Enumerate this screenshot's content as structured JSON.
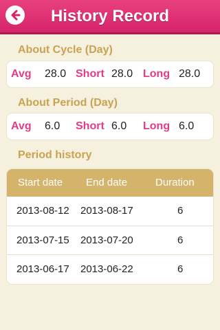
{
  "header": {
    "title": "History Record"
  },
  "icons": {
    "back": "back-arrow-icon"
  },
  "colors": {
    "accent": "#e23c86",
    "gold": "#c9a352",
    "header_bg": "#d6246a"
  },
  "cycle": {
    "label": "About Cycle (Day)",
    "avg_label": "Avg",
    "avg_value": "28.0",
    "short_label": "Short",
    "short_value": "28.0",
    "long_label": "Long",
    "long_value": "28.0"
  },
  "period": {
    "label": "About Period (Day)",
    "avg_label": "Avg",
    "avg_value": "6.0",
    "short_label": "Short",
    "short_value": "6.0",
    "long_label": "Long",
    "long_value": "6.0"
  },
  "history": {
    "label": "Period history",
    "columns": [
      "Start date",
      "End date",
      "Duration"
    ],
    "rows": [
      [
        "2013-08-12",
        "2013-08-17",
        "6"
      ],
      [
        "2013-07-15",
        "2013-07-20",
        "6"
      ],
      [
        "2013-06-17",
        "2013-06-22",
        "6"
      ]
    ]
  }
}
